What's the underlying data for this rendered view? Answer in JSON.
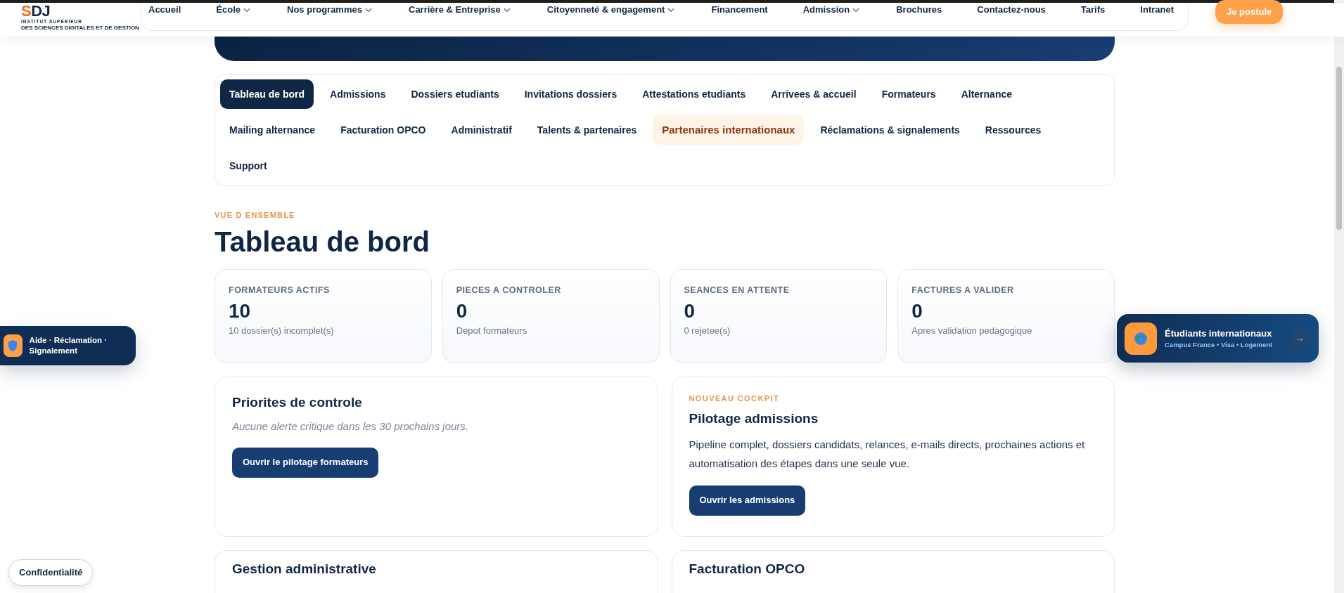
{
  "header": {
    "logo": {
      "letters": "SDJ",
      "line1": "INSTITUT SUPÉRIEUR",
      "line2": "DES SCIENCES DIGITALES ET DE GESTION"
    },
    "nav": [
      {
        "label": "Accueil",
        "dropdown": false
      },
      {
        "label": "École",
        "dropdown": true
      },
      {
        "label": "Nos programmes",
        "dropdown": true
      },
      {
        "label": "Carrière & Entreprise",
        "dropdown": true
      },
      {
        "label": "Citoyenneté & engagement",
        "dropdown": true
      },
      {
        "label": "Financement",
        "dropdown": false
      },
      {
        "label": "Admission",
        "dropdown": true
      },
      {
        "label": "Brochures",
        "dropdown": false
      },
      {
        "label": "Contactez-nous",
        "dropdown": false
      },
      {
        "label": "Tarifs",
        "dropdown": false
      },
      {
        "label": "Intranet",
        "dropdown": false
      }
    ],
    "cta": "Je postule"
  },
  "tabs": [
    {
      "label": "Tableau de bord",
      "selected": true,
      "highlighted": false
    },
    {
      "label": "Admissions",
      "selected": false,
      "highlighted": false
    },
    {
      "label": "Dossiers etudiants",
      "selected": false,
      "highlighted": false
    },
    {
      "label": "Invitations dossiers",
      "selected": false,
      "highlighted": false
    },
    {
      "label": "Attestations etudiants",
      "selected": false,
      "highlighted": false
    },
    {
      "label": "Arrivees & accueil",
      "selected": false,
      "highlighted": false
    },
    {
      "label": "Formateurs",
      "selected": false,
      "highlighted": false
    },
    {
      "label": "Alternance",
      "selected": false,
      "highlighted": false
    },
    {
      "label": "Mailing alternance",
      "selected": false,
      "highlighted": false
    },
    {
      "label": "Facturation OPCO",
      "selected": false,
      "highlighted": false
    },
    {
      "label": "Administratif",
      "selected": false,
      "highlighted": false
    },
    {
      "label": "Talents & partenaires",
      "selected": false,
      "highlighted": false
    },
    {
      "label": "Partenaires internationaux",
      "selected": false,
      "highlighted": true
    },
    {
      "label": "Réclamations & signalements",
      "selected": false,
      "highlighted": false
    },
    {
      "label": "Ressources",
      "selected": false,
      "highlighted": false
    },
    {
      "label": "Support",
      "selected": false,
      "highlighted": false
    }
  ],
  "overview": {
    "eyebrow": "VUE D ENSEMBLE",
    "title": "Tableau de bord"
  },
  "stats": [
    {
      "label": "FORMATEURS ACTIFS",
      "value": "10",
      "note": "10 dossier(s) incomplet(s)"
    },
    {
      "label": "PIECES A CONTROLER",
      "value": "0",
      "note": "Depot formateurs"
    },
    {
      "label": "SEANCES EN ATTENTE",
      "value": "0",
      "note": "0 rejetee(s)"
    },
    {
      "label": "FACTURES A VALIDER",
      "value": "0",
      "note": "Apres validation pedagogique"
    }
  ],
  "panels": [
    {
      "title": "Priorites de controle",
      "text": "Aucune alerte critique dans les 30 prochains jours.",
      "kind": "empty",
      "button": "Ouvrir le pilotage formateurs"
    },
    {
      "eyebrow": "NOUVEAU COCKPIT",
      "title": "Pilotage admissions",
      "text": "Pipeline complet, dossiers candidats, relances, e-mails directs, prochaines actions et automatisation des étapes dans une seule vue.",
      "kind": "info",
      "button": "Ouvrir les admissions"
    },
    {
      "title": "Gestion administrative"
    },
    {
      "title": "Facturation OPCO"
    }
  ],
  "help_badge": "Aide · Réclamation · Signalement",
  "intl_badge": {
    "title": "Étudiants internationaux",
    "subtitle": "Campus France • Visa • Logement",
    "arrow": "→"
  },
  "privacy": "Confidentialité"
}
